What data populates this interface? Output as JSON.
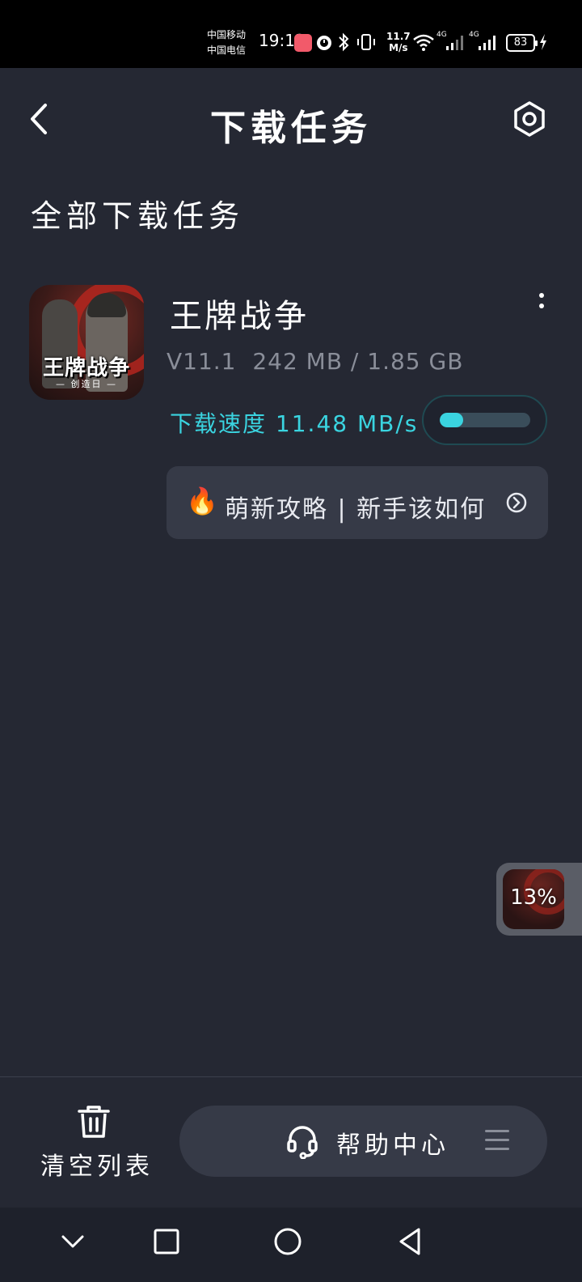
{
  "status_bar": {
    "carrier_1": "中国移动",
    "carrier_2": "中国电信",
    "time": "19:13",
    "net_speed_value": "11.7",
    "net_speed_unit": "M/s",
    "signal_1_label": "4G",
    "signal_2_label": "4G",
    "battery": "83"
  },
  "header": {
    "title": "下载任务"
  },
  "section": {
    "title": "全部下载任务"
  },
  "task": {
    "icon_logo_text": "王牌战争",
    "icon_logo_sub": "— 创造日 —",
    "name": "王牌战争",
    "version": "V11.1",
    "size_progress": "242 MB / 1.85 GB",
    "speed_label": "下载速度",
    "speed_value": "11.48 MB/s",
    "progress_fraction": 0.13
  },
  "guide_banner": {
    "icon": "fire-icon",
    "text": "萌新攻略 | 新手该如何"
  },
  "float_widget": {
    "percent": "13%"
  },
  "bottom_bar": {
    "clear_label": "清空列表",
    "help_label": "帮助中心"
  },
  "colors": {
    "background": "#252833",
    "accent": "#3ad4e0",
    "card": "#363a47"
  }
}
